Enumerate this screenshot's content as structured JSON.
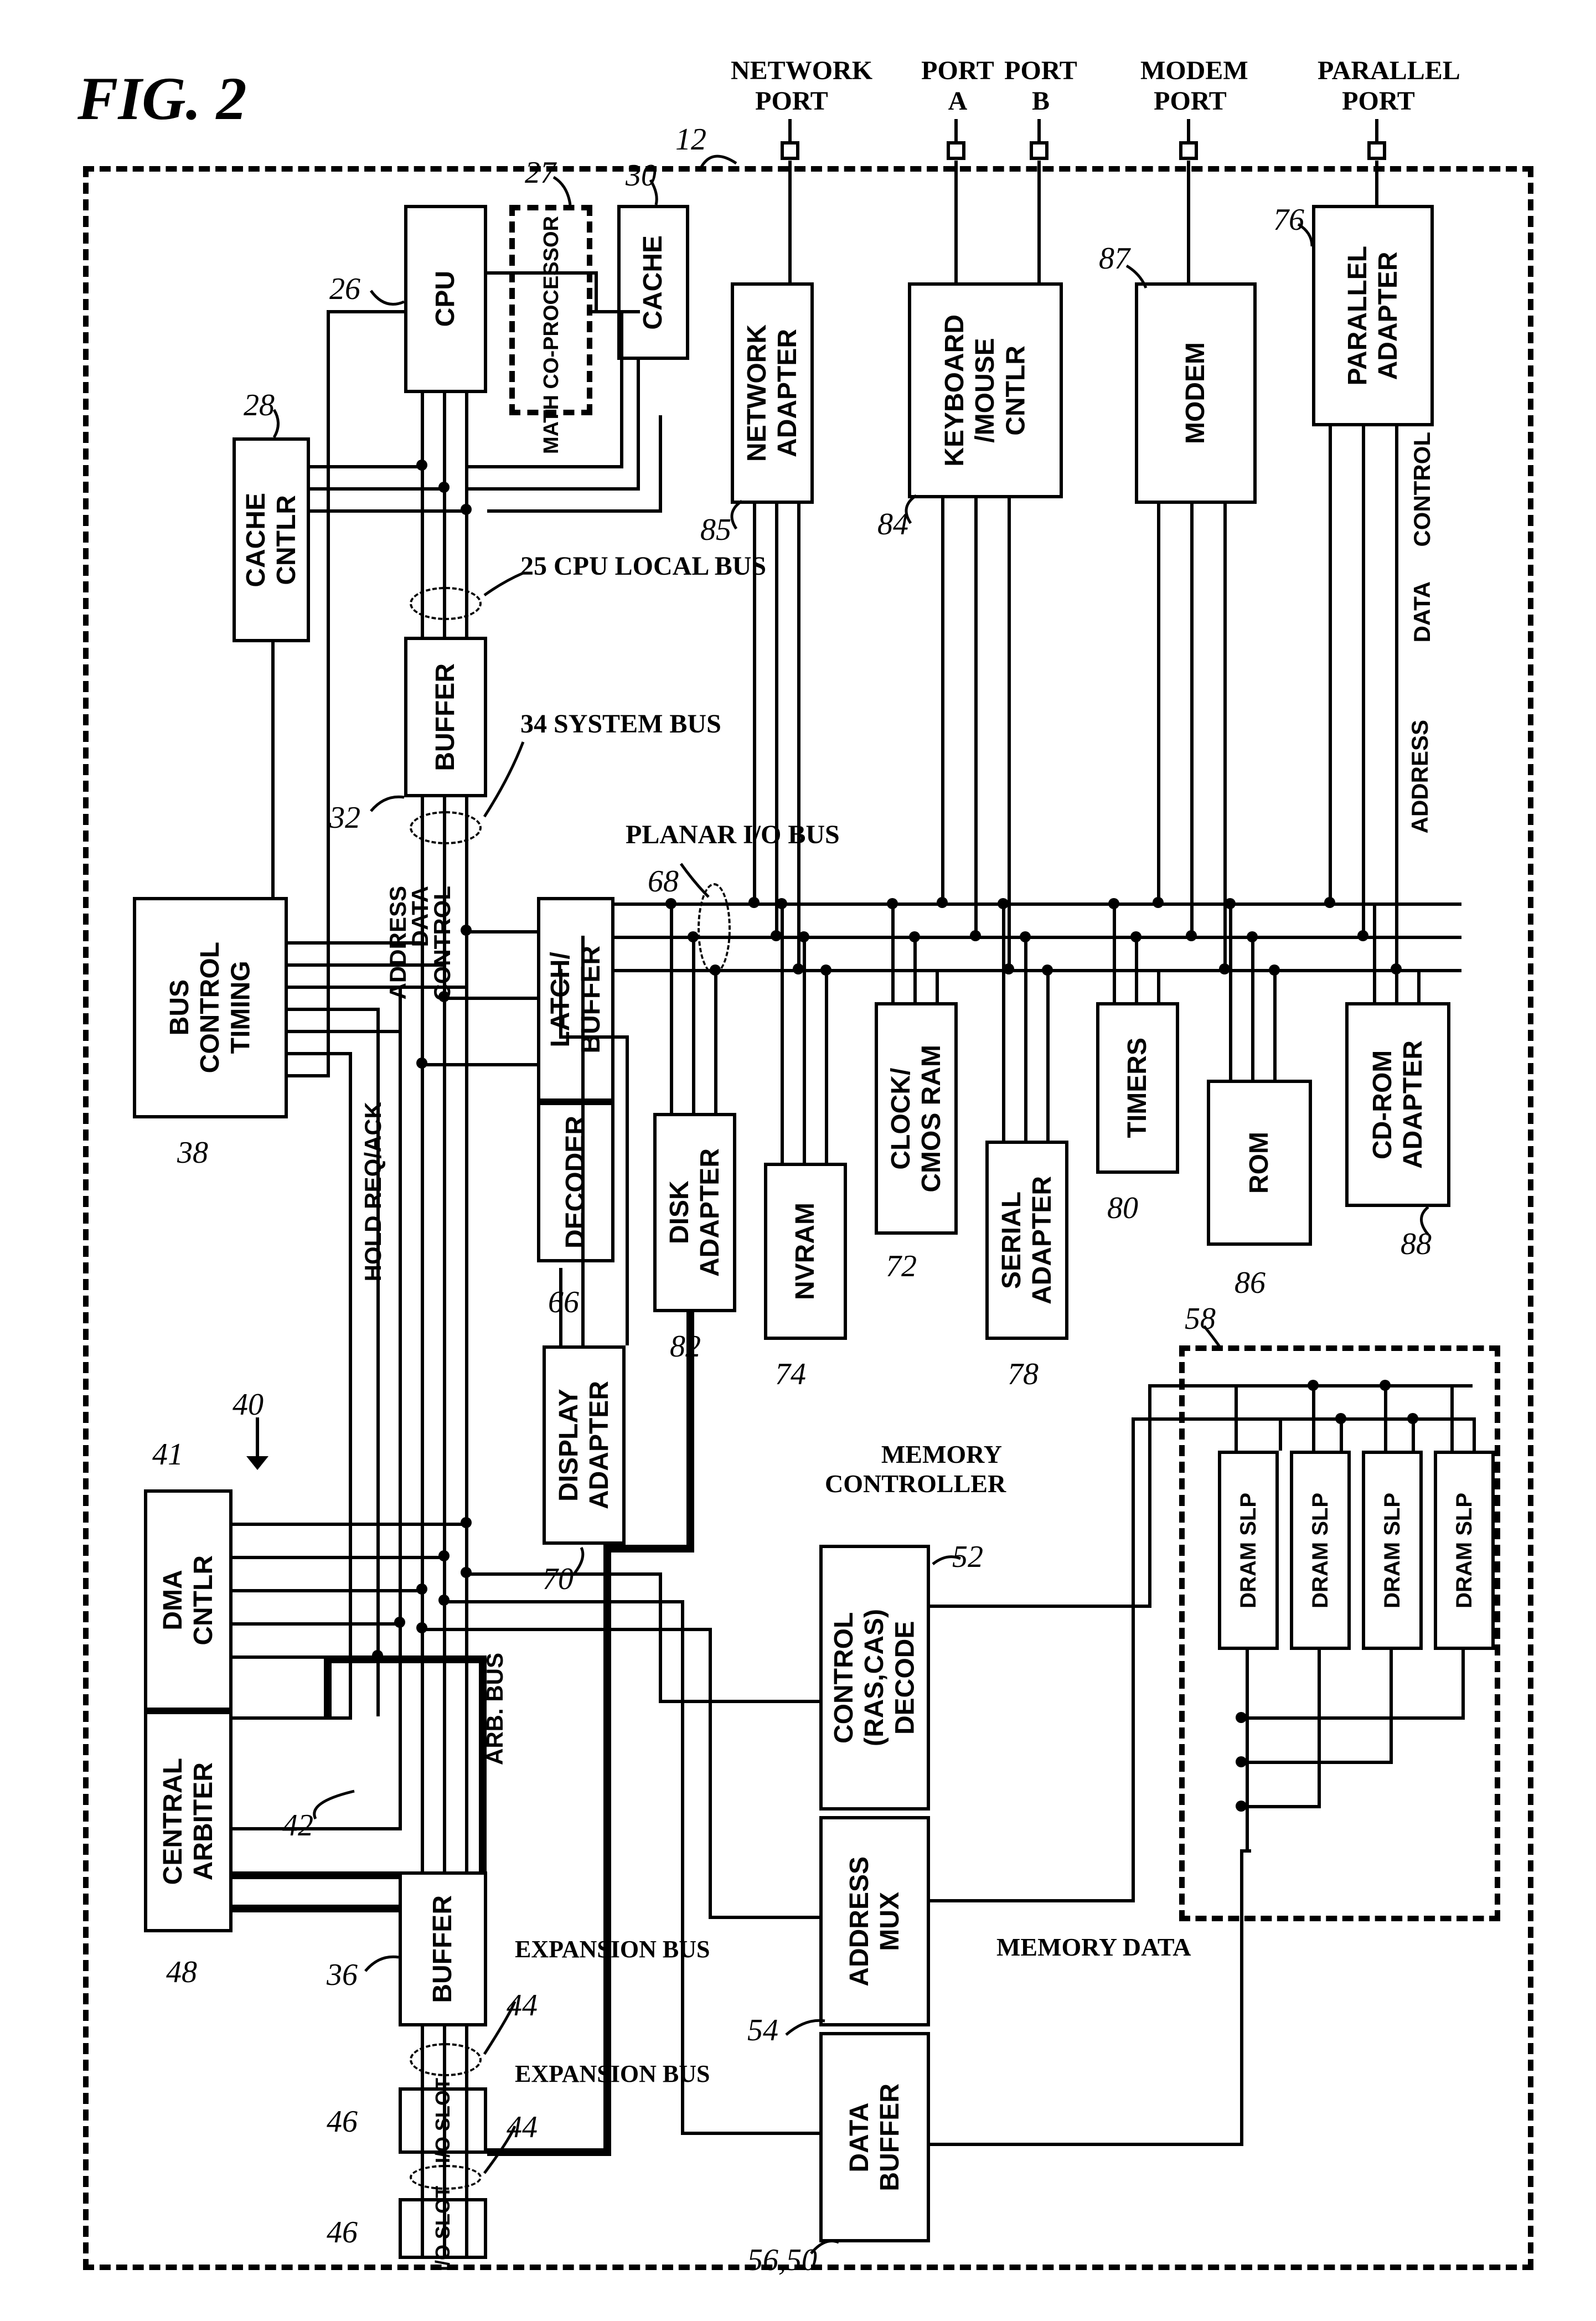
{
  "figure": {
    "title": "FIG. 2"
  },
  "planar_ref": "12",
  "ports": {
    "network": {
      "label": "NETWORK\nPORT"
    },
    "portA": {
      "label": "PORT\nA"
    },
    "portB": {
      "label": "PORT\nB"
    },
    "modem": {
      "label": "MODEM\nPORT"
    },
    "parallel": {
      "label": "PARALLEL\nPORT"
    }
  },
  "blocks": {
    "cpu": {
      "label": "CPU",
      "ref": "26"
    },
    "math": {
      "label": "MATH CO-PROCESSOR",
      "ref": "27"
    },
    "cache": {
      "label": "CACHE",
      "ref": "30"
    },
    "cache_cntlr": {
      "label": "CACHE\nCNTLR",
      "ref": "28"
    },
    "buffer1": {
      "label": "BUFFER",
      "ref": "32"
    },
    "bus_control_timing": {
      "label": "BUS\nCONTROL\nTIMING",
      "ref": "38"
    },
    "latch_buffer": {
      "label": "LATCH/\nBUFFER"
    },
    "decoder": {
      "label": "DECODER",
      "ref": "66"
    },
    "network_adapter": {
      "label": "NETWORK\nADAPTER",
      "ref": "85"
    },
    "kb_mouse": {
      "label": "KEYBOARD\n/MOUSE\nCNTLR",
      "ref": "84"
    },
    "modem": {
      "label": "MODEM",
      "ref": "87"
    },
    "parallel_adapter": {
      "label": "PARALLEL\nADAPTER",
      "ref": "76"
    },
    "display_adapter": {
      "label": "DISPLAY\nADAPTER",
      "ref": "70"
    },
    "disk_adapter": {
      "label": "DISK\nADAPTER",
      "ref": "82"
    },
    "nvram": {
      "label": "NVRAM",
      "ref": "74"
    },
    "clock_cmos": {
      "label": "CLOCK/\nCMOS RAM",
      "ref": "72"
    },
    "serial_adapter": {
      "label": "SERIAL\nADAPTER",
      "ref": "78"
    },
    "timers": {
      "label": "TIMERS",
      "ref": "80"
    },
    "rom": {
      "label": "ROM",
      "ref": "86"
    },
    "cdrom": {
      "label": "CD-ROM\nADAPTER",
      "ref": "88"
    },
    "dma_cntlr": {
      "label": "DMA\nCNTLR",
      "ref": "41"
    },
    "central_arbiter": {
      "label": "CENTRAL\nARBITER",
      "ref": "48"
    },
    "dma_ref": "40",
    "arb_bus_ref": "42",
    "buffer2": {
      "label": "BUFFER",
      "ref": "36"
    },
    "io_slot1": {
      "label": "I/O SLOT",
      "ref": "46"
    },
    "io_slot2": {
      "label": "I/O SLOT",
      "ref": "46"
    },
    "expansion_bus1": {
      "label": "EXPANSION BUS",
      "ref": "44"
    },
    "expansion_bus2": {
      "label": "EXPANSION BUS",
      "ref": "44"
    },
    "mem_ctrl_label": "MEMORY\nCONTROLLER",
    "control_ras": {
      "label": "CONTROL\n(RAS,CAS)\nDECODE",
      "ref": "52"
    },
    "address_mux": {
      "label": "ADDRESS\nMUX",
      "ref": "54"
    },
    "data_buffer": {
      "label": "DATA\nBUFFER",
      "ref": "56,50"
    },
    "dram1": {
      "label": "DRAM SLP"
    },
    "dram2": {
      "label": "DRAM SLP"
    },
    "dram3": {
      "label": "DRAM SLP"
    },
    "dram4": {
      "label": "DRAM SLP"
    },
    "dram_ref": "58",
    "memory_data": "MEMORY DATA"
  },
  "bus_labels": {
    "cpu_local_bus": "25 CPU LOCAL BUS",
    "system_bus": "34 SYSTEM BUS",
    "planar_io_bus": "PLANAR I/O BUS",
    "planar_io_ref": "68",
    "control": "CONTROL",
    "data": "DATA",
    "address": "ADDRESS",
    "hold_req_ack": "HOLD REQ/ACK",
    "arb_bus": "ARB. BUS"
  }
}
